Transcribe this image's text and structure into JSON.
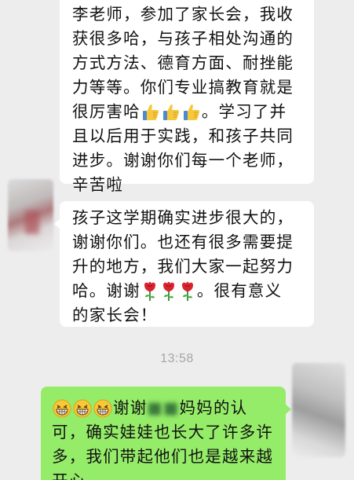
{
  "messages": [
    {
      "side": "left",
      "lines": [
        "李老师，参加了家长会，我收",
        "获很多哈，与孩子相处沟通的",
        "方式方法、德育方面、耐挫能",
        "力等等。你们专业搞教育就是",
        "很厉害哈",
        "。学习了并",
        "且以后用于实践，和孩子共同",
        "进步。谢谢你们每一个老师，",
        "辛苦啦"
      ],
      "emoji": [
        "thumbs-up-icon",
        "thumbs-up-icon",
        "thumbs-up-icon"
      ]
    },
    {
      "side": "left",
      "lines": [
        "孩子这学期确实进步很大的，",
        "谢谢你们。也还有很多需要提",
        "升的地方，我们大家一起努力",
        "哈。谢谢",
        "。很有意义",
        "的家长会！"
      ],
      "emoji": [
        "rose-icon",
        "rose-icon",
        "rose-icon"
      ]
    },
    {
      "side": "right",
      "lines": [
        "谢谢",
        "妈妈的认",
        "可，确实娃娃也长大了许多许",
        "多，我们带起他们也是越来越",
        "开心"
      ],
      "emoji": [
        "grinning-face-icon",
        "grinning-face-icon",
        "grinning-face-icon"
      ]
    }
  ],
  "timestamp": "13:58",
  "colors": {
    "background": "#ededed",
    "incoming_bubble": "#ffffff",
    "outgoing_bubble": "#95ec69",
    "timestamp_text": "#a6a6a6"
  }
}
